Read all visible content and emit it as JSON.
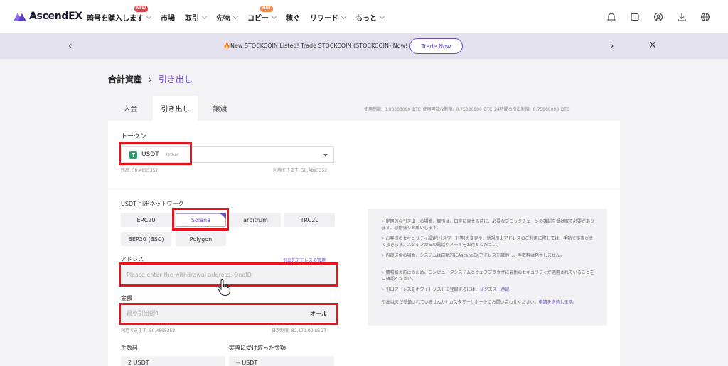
{
  "brand": {
    "name": "AscendEX"
  },
  "nav": {
    "items": [
      {
        "label": "暗号を購入します",
        "badge": "NEW",
        "chevron": true
      },
      {
        "label": "市場",
        "chevron": false
      },
      {
        "label": "取引",
        "chevron": true
      },
      {
        "label": "先物",
        "chevron": true
      },
      {
        "label": "コピー",
        "badge": "HOT",
        "chevron": true
      },
      {
        "label": "稼ぐ",
        "chevron": false
      },
      {
        "label": "リワード",
        "chevron": true
      },
      {
        "label": "もっと",
        "chevron": true
      }
    ],
    "icons": [
      "bell-icon",
      "wallet-icon",
      "user-icon",
      "download-icon",
      "globe-icon"
    ]
  },
  "banner": {
    "text": "🔥New STOCKCOIN Listed! Trade STOCKCOIN (STOCKCOIN) Now!",
    "button": "Trade Now",
    "prev": "‹",
    "next": "›",
    "close": "✕"
  },
  "breadcrumb": {
    "root": "合計資産",
    "separator": "›",
    "current": "引き出し"
  },
  "tabs": [
    {
      "label": "入金",
      "active": false
    },
    {
      "label": "引き出し",
      "active": true
    },
    {
      "label": "譲渡",
      "active": false
    }
  ],
  "limits": "使用制限: 0.00000000 BTC    使用可能な制限: 0.75000000 BTC    24時間の引出制限: 0.75000000 BTC",
  "token": {
    "section_label": "トークン",
    "icon_letter": "T",
    "symbol": "USDT",
    "name": "Tether",
    "balance": "残高: 50.4895352",
    "available": "利用できます: 50.4895352"
  },
  "network": {
    "section_label": "USDT 引出ネットワーク",
    "options": [
      {
        "label": "ERC20",
        "selected": false
      },
      {
        "label": "Solana",
        "selected": true
      },
      {
        "label": "arbitrum",
        "selected": false
      },
      {
        "label": "TRC20",
        "selected": false
      },
      {
        "label": "BEP20 (BSC)",
        "selected": false
      },
      {
        "label": "Polygon",
        "selected": false
      }
    ]
  },
  "address": {
    "label": "アドレス",
    "manage_link": "引出先アドレスの管理",
    "placeholder": "Please enter the withdrawal address, OneID"
  },
  "amount": {
    "label": "金額",
    "placeholder": "最小引出額4",
    "all_button": "オール",
    "available": "利用できます: 50.4895352",
    "daily_limit": "日次制限: 82,171.00 USDT"
  },
  "fee": {
    "label": "手数料",
    "value": "2 USDT"
  },
  "received": {
    "label": "実際に受け取った金額",
    "value": "-- USDT"
  },
  "notice": {
    "items": [
      "• 定期的な引き出しの場合、取引は、口座に戻せる前に、必要なブロックチェーンの確認を受け取る必要があります。忍耐強くお願いします。",
      "• お客様のセキュリティ設定(パスワード等)の変更や、新規引出アドレスのご利用に際しては、手動で審査させて頂きます。スタッフからの電話やメールをお待ちください。",
      "• 内部送金の場合、システムは自動的にAscendEXアドレスを識別し、手数料は発生しません。",
      "• 情報漏え防止のため、コンピュータシステムとウェブブラウザに最新のセキュリティが適用されていることをご確認ください。",
      "• 引出アドレスをホワイトリストに登録するには、"
    ],
    "whitelist_link": "リクエスト承認",
    "bottom_text": "引出はまだ受領されていませんか? カスタマーサポートにお問い合わせください。",
    "bottom_link": "申請を送信します。"
  },
  "colors": {
    "accent": "#6b4ac6",
    "highlight": "#e8141b",
    "token_green": "#2f9a6b"
  }
}
